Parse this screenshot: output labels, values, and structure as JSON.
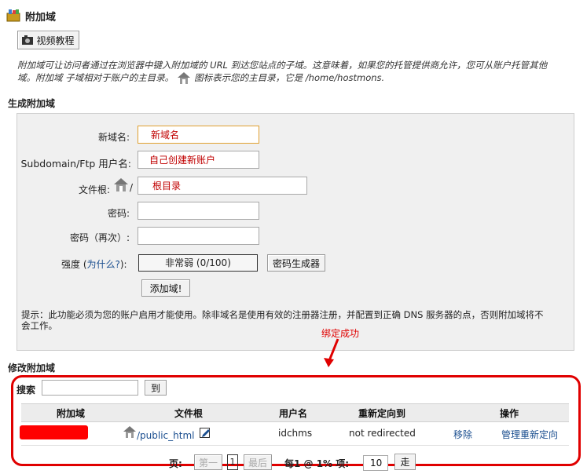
{
  "header": {
    "title": "附加域",
    "video_button": "视频教程"
  },
  "intro": {
    "line1": "附加域可让访问者通过在浏览器中键入附加域的 URL 到达您站点的子域。这意味着，如果您的托管提供商允许，您可从账户托管其他",
    "line2a": "域。附加域 子域相对于账户的主目录。",
    "line2b": "图标表示您的主目录，它是 /home/hostmons."
  },
  "create": {
    "section_title": "生成附加域",
    "domain_label": "新域名:",
    "domain_value": "新域名",
    "user_label": "Subdomain/Ftp 用户名:",
    "user_value": "自己创建新账户",
    "root_label": "文件根:",
    "root_slash": "/",
    "root_value": "根目录",
    "pass_label": "密码:",
    "pass2_label": "密码（再次）:",
    "strength_label_pre": "强度 (",
    "strength_link": "为什么?",
    "strength_label_post": "):",
    "strength_value": "非常弱 (0/100)",
    "generator_button": "密码生成器",
    "add_button": "添加域!",
    "hint_line1": "提示：此功能必须为您的账户启用才能使用。除非域名是使用有效的注册器注册，并配置到正确 DNS 服务器的点，否则附加域将不",
    "hint_line2": "会工作。"
  },
  "annotation": {
    "text": "绑定成功",
    "color": "#e00000"
  },
  "modify": {
    "section_title": "修改附加域",
    "search_label": "搜索",
    "search_value": "",
    "go_button": "到",
    "columns": [
      "附加域",
      "文件根",
      "用户名",
      "重新定向到",
      "操作"
    ],
    "row": {
      "domain": "",
      "docroot": "/public_html",
      "username": "idchms",
      "redirect": "not redirected",
      "action_remove": "移除",
      "action_redirect": "管理重新定向"
    },
    "pager": {
      "page_label": "页:",
      "first": "第一",
      "current": "1",
      "last": "最后",
      "per_page_label": "每1 @ 1% 项:",
      "per_page_value": "10",
      "go": "走"
    }
  }
}
